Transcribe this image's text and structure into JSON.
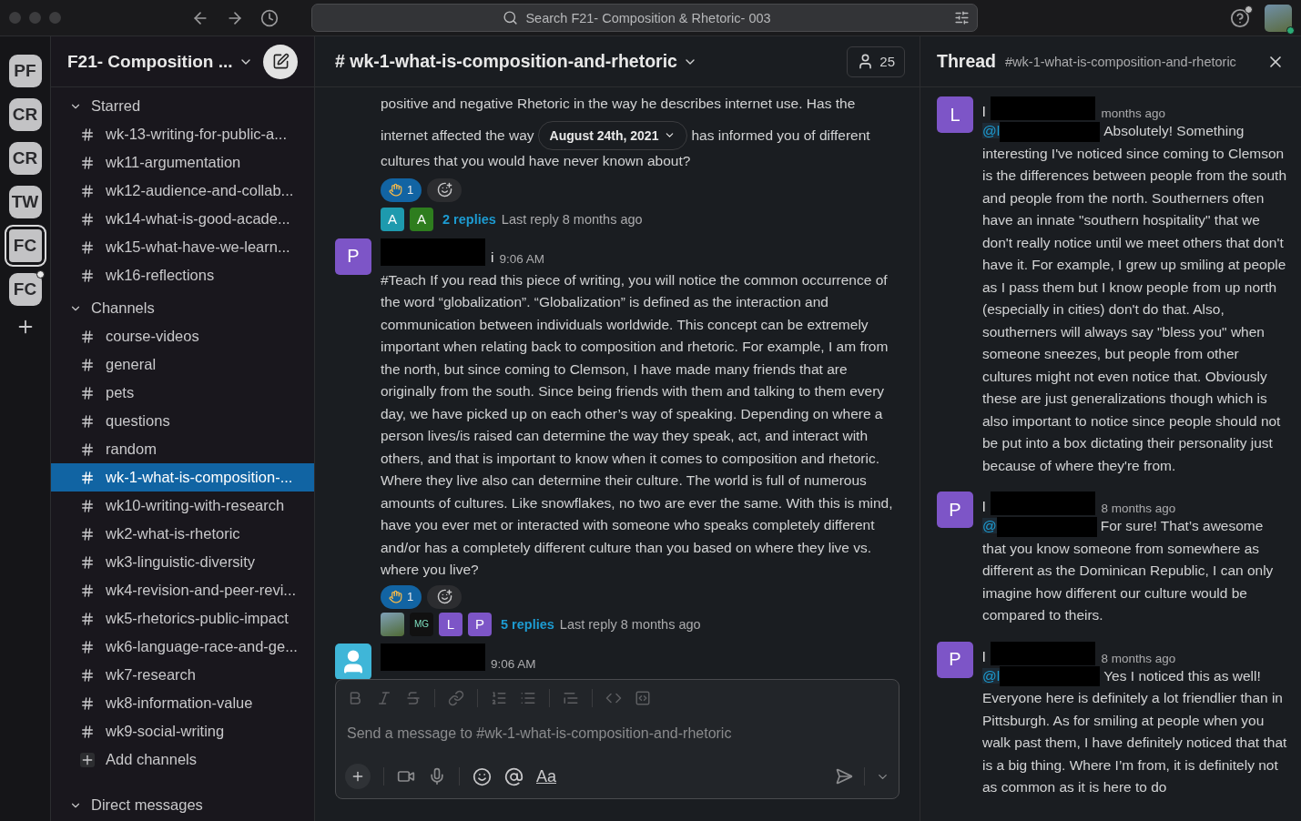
{
  "topbar": {
    "search_placeholder": "Search F21- Composition & Rhetoric- 003",
    "help_badge": true
  },
  "workspaces": [
    {
      "label": "PF",
      "selected": false,
      "badge": false
    },
    {
      "label": "CR",
      "selected": false,
      "badge": false
    },
    {
      "label": "CR",
      "selected": false,
      "badge": false
    },
    {
      "label": "TW",
      "selected": false,
      "badge": false
    },
    {
      "label": "FC",
      "selected": true,
      "badge": false
    },
    {
      "label": "FC",
      "selected": false,
      "badge": true
    }
  ],
  "sidebar": {
    "workspace_name": "F21- Composition ...",
    "sections": [
      {
        "title": "Starred",
        "expanded": true,
        "items": [
          {
            "name": "wk-13-writing-for-public-a...",
            "selected": false
          },
          {
            "name": "wk11-argumentation",
            "selected": false
          },
          {
            "name": "wk12-audience-and-collab...",
            "selected": false
          },
          {
            "name": "wk14-what-is-good-acade...",
            "selected": false
          },
          {
            "name": "wk15-what-have-we-learn...",
            "selected": false
          },
          {
            "name": "wk16-reflections",
            "selected": false
          }
        ]
      },
      {
        "title": "Channels",
        "expanded": true,
        "items": [
          {
            "name": "course-videos",
            "selected": false
          },
          {
            "name": "general",
            "selected": false
          },
          {
            "name": "pets",
            "selected": false
          },
          {
            "name": "questions",
            "selected": false
          },
          {
            "name": "random",
            "selected": false
          },
          {
            "name": "wk-1-what-is-composition-...",
            "selected": true
          },
          {
            "name": "wk10-writing-with-research",
            "selected": false
          },
          {
            "name": "wk2-what-is-rhetoric",
            "selected": false
          },
          {
            "name": "wk3-linguistic-diversity",
            "selected": false
          },
          {
            "name": "wk4-revision-and-peer-revi...",
            "selected": false
          },
          {
            "name": "wk5-rhetorics-public-impact",
            "selected": false
          },
          {
            "name": "wk6-language-race-and-ge...",
            "selected": false
          },
          {
            "name": "wk7-research",
            "selected": false
          },
          {
            "name": "wk8-information-value",
            "selected": false
          },
          {
            "name": "wk9-social-writing",
            "selected": false
          }
        ],
        "add_label": "Add channels"
      },
      {
        "title": "Direct messages",
        "expanded": true
      }
    ]
  },
  "channel": {
    "title": "# wk-1-what-is-composition-and-rhetoric",
    "members": "25",
    "date_divider": "August 24th, 2021",
    "messages": [
      {
        "kind": "continued",
        "lines": [
          "positive and negative Rhetoric in the way he describes internet use. Has the"
        ],
        "before_date": "internet affected the way",
        "after_date": "has informed you of different",
        "rest": "cultures that you would have never known about?",
        "reaction": {
          "count": "1",
          "reacted": true
        },
        "replies": {
          "avatars": [
            {
              "kind": "letter",
              "label": "A",
              "color": "#1e9aae"
            },
            {
              "kind": "letter",
              "label": "A",
              "color": "#2e7d1e"
            }
          ],
          "count": "2 replies",
          "last": "Last reply 8 months ago"
        }
      },
      {
        "kind": "full",
        "avatar": {
          "kind": "letter",
          "label": "P",
          "color": "#7d55c7"
        },
        "author_tail": "i",
        "time": "9:06 AM",
        "text": "#Teach If you read this piece of writing, you will notice the common occurrence of the word “globalization”. “Globalization” is defined as the interaction and communication between individuals worldwide. This concept can be extremely important when relating back to composition and rhetoric. For example, I am from the north, but since coming to Clemson, I have made many friends that are originally from the south. Since being friends with them and talking to them every day, we have picked up on each other’s way of speaking. Depending on where a person lives/is raised can determine the way they speak, act, and interact with others, and that is important to know when it comes to composition and rhetoric. Where they live also can determine their culture. The world is full of numerous amounts of cultures. Like snowflakes, no two are ever the same. With this is mind, have you ever met or interacted with someone who speaks completely different and/or has a completely different culture than you based on where they live vs. where you live?",
        "reaction": {
          "count": "1",
          "reacted": true
        },
        "replies": {
          "avatars": [
            {
              "kind": "photo"
            },
            {
              "kind": "letter",
              "label": "MG",
              "color": "#111111"
            },
            {
              "kind": "letter",
              "label": "L",
              "color": "#7d55c7"
            },
            {
              "kind": "letter",
              "label": "P",
              "color": "#7d55c7"
            }
          ],
          "count": "5 replies",
          "last": "Last reply 8 months ago"
        }
      },
      {
        "kind": "full",
        "avatar": {
          "kind": "silhouette",
          "color": "#3fb6d8"
        },
        "time": "9:06 AM"
      }
    ],
    "composer": {
      "placeholder": "Send a message to #wk-1-what-is-composition-and-rhetoric",
      "format_label": "Aa"
    }
  },
  "thread": {
    "title": "Thread",
    "channel": "#wk-1-what-is-composition-and-rhetoric",
    "messages": [
      {
        "avatar": "L",
        "author_head": "l",
        "time": "months ago",
        "mention": "@l",
        "text": "Absolutely! Something interesting I've noticed since coming to Clemson is the differences between people from the south and people from the north. Southerners often have an innate \"southern hospitality\" that we don't really notice until we meet others that don't have it. For example, I grew up smiling at people as I pass them but I know people from up north (especially in cities) don't do that. Also, southerners will always say \"bless you\" when someone sneezes, but people from other cultures might not even notice that. Obviously these are just generalizations though which is also important to notice since people should not be put into a box dictating their personality just because of where they're from."
      },
      {
        "avatar": "P",
        "author_head": "l",
        "time": "8 months ago",
        "mention": "@",
        "text": "For sure! That’s awesome that you know someone from somewhere as different as the Dominican Republic, I can only imagine how different our culture would be compared to theirs."
      },
      {
        "avatar": "P",
        "author_head": "l",
        "time": "8 months ago",
        "mention": "@l",
        "text": "Yes I noticed this as well! Everyone here is definitely a lot friendlier than in Pittsburgh. As for smiling at people when you walk past them, I have definitely noticed that that is a big thing. Where I’m from, it is definitely not as common as it is here to do"
      }
    ]
  }
}
